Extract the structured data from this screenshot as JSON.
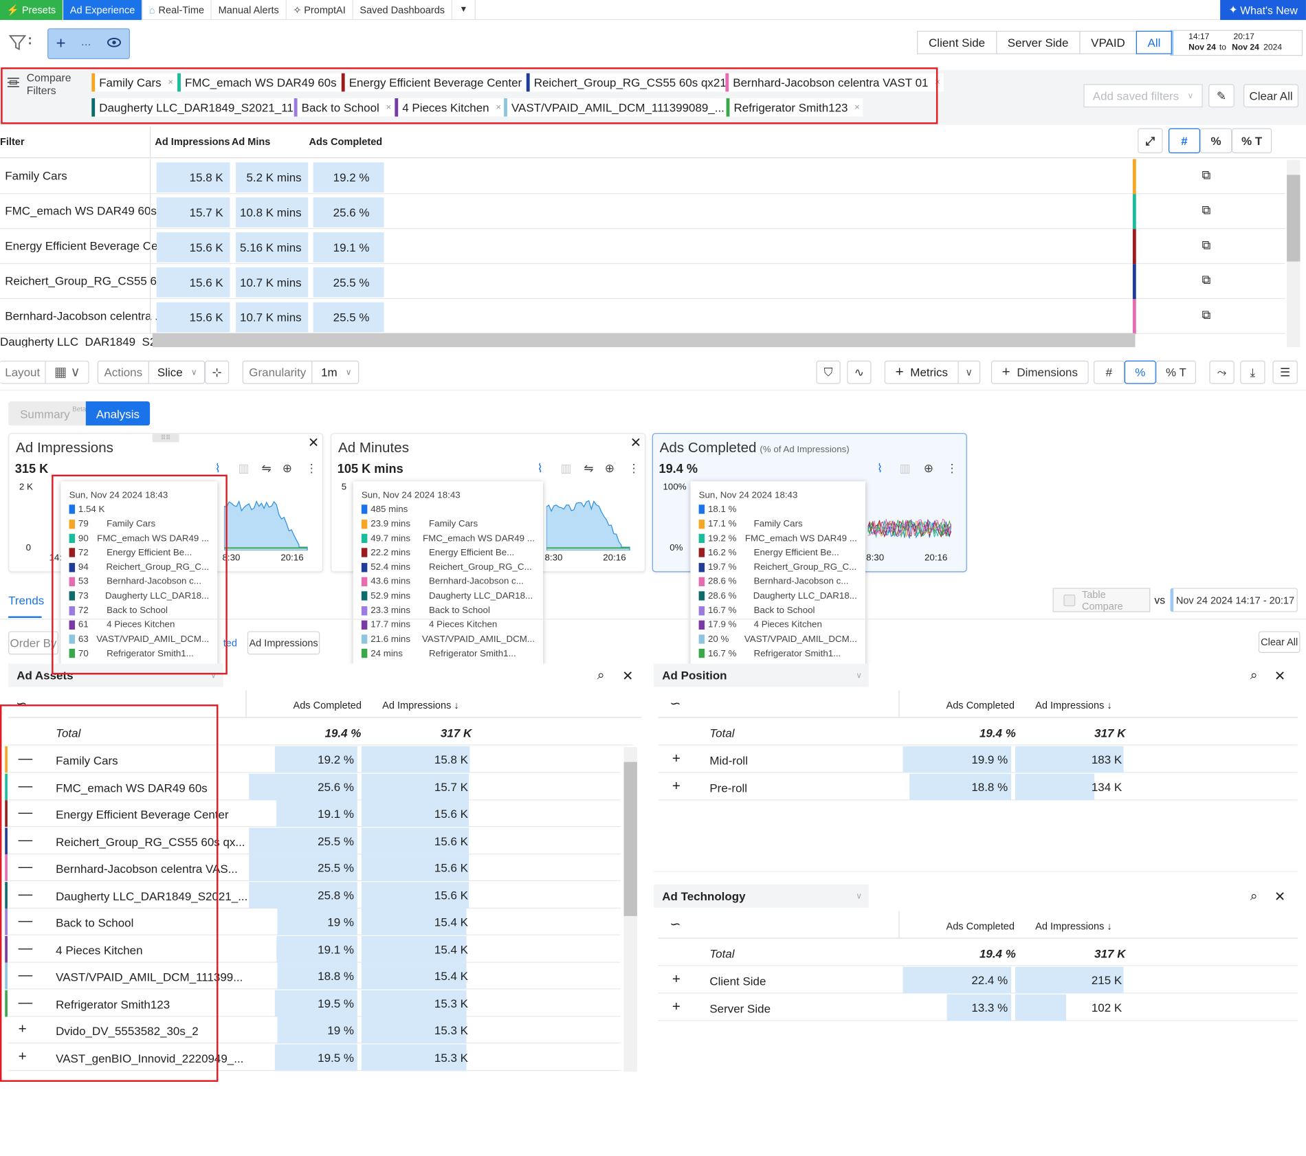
{
  "topnav": {
    "presets": "Presets",
    "ad_experience": "Ad Experience",
    "realtime": "Real-Time",
    "manual_alerts": "Manual Alerts",
    "promptai": "PromptAI",
    "saved_dashboards": "Saved Dashboards",
    "whats_new": "What's New"
  },
  "sides": [
    "Client Side",
    "Server Side",
    "VPAID",
    "All"
  ],
  "date": {
    "start_time": "14:17",
    "end_time": "20:17",
    "start_day": "Nov 24",
    "to": "to",
    "end_day": "Nov 24",
    "year": "2024"
  },
  "compare": {
    "label1": "Compare",
    "label2": "Filters",
    "add_saved": "Add saved filters",
    "clear_all": "Clear All",
    "chips": [
      {
        "name": "Family Cars",
        "color": "#f5a623"
      },
      {
        "name": "FMC_emach WS DAR49 60s",
        "color": "#1abc9c"
      },
      {
        "name": "Energy Efficient Beverage Center",
        "color": "#9b1c1c"
      },
      {
        "name": "Reichert_Group_RG_CS55 60s qx21",
        "color": "#1f3c99"
      },
      {
        "name": "Bernhard-Jacobson celentra VAST 01",
        "color": "#e66bb0"
      },
      {
        "name": "Daugherty LLC_DAR1849_S2021_11",
        "color": "#0e6b6b"
      },
      {
        "name": "Back to School",
        "color": "#9b7be0"
      },
      {
        "name": "4 Pieces Kitchen",
        "color": "#7a3aa5"
      },
      {
        "name": "VAST/VPAID_AMIL_DCM_111399089_...",
        "color": "#8dc5e0"
      },
      {
        "name": "Refrigerator Smith123",
        "color": "#3aa84a"
      }
    ]
  },
  "toptable": {
    "headers": {
      "filter": "Filter",
      "imp": "Ad Impressions",
      "mins": "Ad Mins",
      "comp": "Ads Completed"
    },
    "modes": [
      "#",
      "%",
      "% T"
    ],
    "rows": [
      {
        "name": "Family Cars",
        "imp": "15.8 K",
        "mins": "5.2 K mins",
        "comp": "19.2 %",
        "color": "#f5a623"
      },
      {
        "name": "FMC_emach WS DAR49 60s",
        "imp": "15.7 K",
        "mins": "10.8 K mins",
        "comp": "25.6 %",
        "color": "#1abc9c"
      },
      {
        "name": "Energy Efficient Beverage Ce...",
        "imp": "15.6 K",
        "mins": "5.16 K mins",
        "comp": "19.1 %",
        "color": "#9b1c1c"
      },
      {
        "name": "Reichert_Group_RG_CS55 60...",
        "imp": "15.6 K",
        "mins": "10.7 K mins",
        "comp": "25.5 %",
        "color": "#1f3c99"
      },
      {
        "name": "Bernhard-Jacobson celentra ...",
        "imp": "15.6 K",
        "mins": "10.7 K mins",
        "comp": "25.5 %",
        "color": "#e66bb0"
      }
    ],
    "partial_row": "Daugherty LLC_DAR1849_S2..."
  },
  "controls": {
    "layout": "Layout",
    "actions": "Actions",
    "slice": "Slice",
    "granularity": "Granularity",
    "gran_value": "1m",
    "metrics": "Metrics",
    "dimensions": "Dimensions",
    "modes": [
      "#",
      "%",
      "% T"
    ]
  },
  "tabs": {
    "summary": "Summary",
    "beta": "Beta",
    "analysis": "Analysis"
  },
  "cards": [
    {
      "title": "Ad Impressions",
      "sub": "",
      "value": "315 K",
      "ymax": "2 K",
      "ymin": "0",
      "x1": "14:",
      "x2": "8:30",
      "x3": "20:16",
      "tooltip": {
        "date": "Sun, Nov 24 2024 18:43",
        "total": "1.54 K",
        "items": [
          "79",
          "90",
          "72",
          "94",
          "53",
          "73",
          "72",
          "61",
          "63",
          "70"
        ]
      }
    },
    {
      "title": "Ad Minutes",
      "sub": "",
      "value": "105 K mins",
      "ymax": "5",
      "ymin": "",
      "x1": "",
      "x2": "8:30",
      "x3": "20:16",
      "tooltip": {
        "date": "Sun, Nov 24 2024 18:43",
        "total": "485 mins",
        "items": [
          "23.9 mins",
          "49.7 mins",
          "22.2 mins",
          "52.4 mins",
          "43.6 mins",
          "52.9 mins",
          "23.3 mins",
          "17.7 mins",
          "21.6 mins",
          "24 mins"
        ]
      }
    },
    {
      "title": "Ads Completed",
      "sub": "(% of Ad Impressions)",
      "value": "19.4 %",
      "ymax": "100%",
      "ymin": "0%",
      "x1": "",
      "x2": "8:30",
      "x3": "20:16",
      "tooltip": {
        "date": "Sun, Nov 24 2024 18:43",
        "total": "18.1 %",
        "items": [
          "17.1 %",
          "19.2 %",
          "16.2 %",
          "19.7 %",
          "28.6 %",
          "28.6 %",
          "16.7 %",
          "17.9 %",
          "20 %",
          "16.7 %"
        ]
      }
    }
  ],
  "tooltip_names": [
    "Family Cars",
    "FMC_emach WS DAR49 ...",
    "Energy Efficient Be...",
    "Reichert_Group_RG_C...",
    "Bernhard-Jacobson c...",
    "Daugherty LLC_DAR18...",
    "Back to School",
    "4 Pieces Kitchen",
    "VAST/VPAID_AMIL_DCM...",
    "Refrigerator Smith1..."
  ],
  "trends": {
    "label": "Trends",
    "order_by": "Order By",
    "chip_partial": "ted",
    "chip_imp": "Ad Impressions",
    "table_compare": "Table Compare",
    "vs": "vs",
    "compare_date": "Nov 24 2024 14:17 - 20:17",
    "clear_all": "Clear All"
  },
  "assets": {
    "title": "Ad Assets",
    "col_comp": "Ads Completed",
    "col_imp": "Ad Impressions ↓",
    "total": {
      "label": "Total",
      "comp": "19.4 %",
      "imp": "317 K"
    },
    "rows": [
      {
        "sign": "—",
        "name": "Family Cars",
        "comp": "19.2 %",
        "imp": "15.8 K",
        "color": "#f5a623",
        "cw": 0.76,
        "iw": 1.0
      },
      {
        "sign": "—",
        "name": "FMC_emach WS DAR49 60s",
        "comp": "25.6 %",
        "imp": "15.7 K",
        "color": "#1abc9c",
        "cw": 1.0,
        "iw": 0.99
      },
      {
        "sign": "—",
        "name": "Energy Efficient Beverage Center",
        "comp": "19.1 %",
        "imp": "15.6 K",
        "color": "#9b1c1c",
        "cw": 0.75,
        "iw": 0.99
      },
      {
        "sign": "—",
        "name": "Reichert_Group_RG_CS55 60s qx...",
        "comp": "25.5 %",
        "imp": "15.6 K",
        "color": "#1f3c99",
        "cw": 1.0,
        "iw": 0.99
      },
      {
        "sign": "—",
        "name": "Bernhard-Jacobson celentra VAS...",
        "comp": "25.5 %",
        "imp": "15.6 K",
        "color": "#e66bb0",
        "cw": 1.0,
        "iw": 0.99
      },
      {
        "sign": "—",
        "name": "Daugherty LLC_DAR1849_S2021_...",
        "comp": "25.8 %",
        "imp": "15.6 K",
        "color": "#0e6b6b",
        "cw": 1.0,
        "iw": 0.99
      },
      {
        "sign": "—",
        "name": "Back to School",
        "comp": "19 %",
        "imp": "15.4 K",
        "color": "#9b7be0",
        "cw": 0.74,
        "iw": 0.97
      },
      {
        "sign": "—",
        "name": "4 Pieces Kitchen",
        "comp": "19.1 %",
        "imp": "15.4 K",
        "color": "#7a3aa5",
        "cw": 0.75,
        "iw": 0.97
      },
      {
        "sign": "—",
        "name": "VAST/VPAID_AMIL_DCM_111399...",
        "comp": "18.8 %",
        "imp": "15.4 K",
        "color": "#8dc5e0",
        "cw": 0.74,
        "iw": 0.97
      },
      {
        "sign": "—",
        "name": "Refrigerator Smith123",
        "comp": "19.5 %",
        "imp": "15.3 K",
        "color": "#3aa84a",
        "cw": 0.76,
        "iw": 0.97
      },
      {
        "sign": "+",
        "name": "Dvido_DV_5553582_30s_2",
        "comp": "19 %",
        "imp": "15.3 K",
        "color": "",
        "cw": 0.74,
        "iw": 0.97
      },
      {
        "sign": "+",
        "name": "VAST_genBIO_Innovid_2220949_...",
        "comp": "19.5 %",
        "imp": "15.3 K",
        "color": "",
        "cw": 0.76,
        "iw": 0.97
      }
    ]
  },
  "position": {
    "title": "Ad Position",
    "col_comp": "Ads Completed",
    "col_imp": "Ad Impressions ↓",
    "total": {
      "label": "Total",
      "comp": "19.4 %",
      "imp": "317 K"
    },
    "rows": [
      {
        "sign": "+",
        "name": "Mid-roll",
        "comp": "19.9 %",
        "imp": "183 K",
        "cw": 1.0,
        "iw": 1.0
      },
      {
        "sign": "+",
        "name": "Pre-roll",
        "comp": "18.8 %",
        "imp": "134 K",
        "cw": 0.94,
        "iw": 0.73
      }
    ]
  },
  "technology": {
    "title": "Ad Technology",
    "col_comp": "Ads Completed",
    "col_imp": "Ad Impressions ↓",
    "total": {
      "label": "Total",
      "comp": "19.4 %",
      "imp": "317 K"
    },
    "rows": [
      {
        "sign": "+",
        "name": "Client Side",
        "comp": "22.4 %",
        "imp": "215 K",
        "cw": 1.0,
        "iw": 1.0
      },
      {
        "sign": "+",
        "name": "Server Side",
        "comp": "13.3 %",
        "imp": "102 K",
        "cw": 0.59,
        "iw": 0.47
      }
    ]
  }
}
